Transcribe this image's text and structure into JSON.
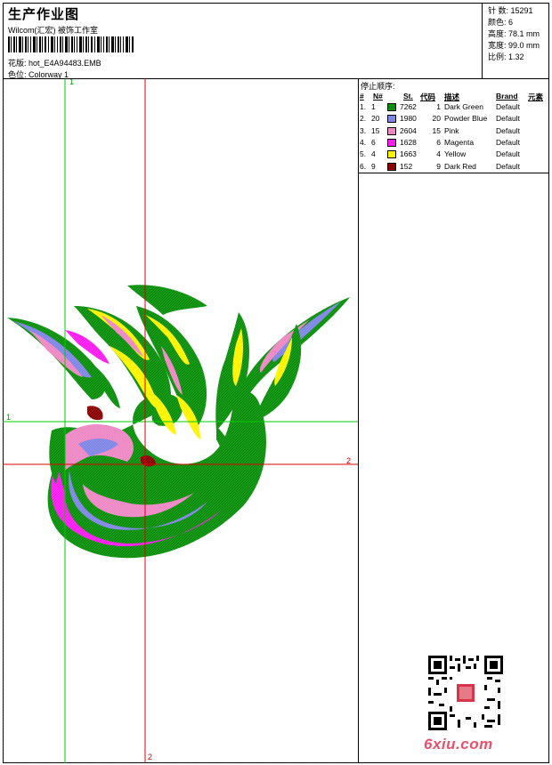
{
  "header": {
    "title": "生产作业图",
    "company": "Wilcom(汇宏)    被饰工作室",
    "design_label": "花版:",
    "design_value": "hot_E4A94483.EMB",
    "colorway_label": "色位:",
    "colorway_value": "Colorway 1"
  },
  "stats": [
    {
      "label": "针 数:",
      "value": "15291"
    },
    {
      "label": "颜色:",
      "value": "6"
    },
    {
      "label": "高度:",
      "value": "78.1 mm"
    },
    {
      "label": "宽度:",
      "value": "99.0 mm"
    },
    {
      "label": "比例:",
      "value": "1.32"
    }
  ],
  "stop_sequence": {
    "title": "停止顺序:",
    "headers": {
      "num": "#",
      "n": "N#",
      "st": "St.",
      "code": "代码",
      "desc": "描述",
      "brand": "Brand",
      "element": "元素"
    },
    "rows": [
      {
        "num": "1.",
        "n": "1",
        "color": "#0a8f0a",
        "st": "7262",
        "code": "1",
        "desc": "Dark Green",
        "brand": "Default"
      },
      {
        "num": "2.",
        "n": "20",
        "color": "#7f86e6",
        "st": "1980",
        "code": "20",
        "desc": "Powder Blue",
        "brand": "Default"
      },
      {
        "num": "3.",
        "n": "15",
        "color": "#ee88c4",
        "st": "2604",
        "code": "15",
        "desc": "Pink",
        "brand": "Default"
      },
      {
        "num": "4.",
        "n": "6",
        "color": "#ff1bf2",
        "st": "1628",
        "code": "6",
        "desc": "Magenta",
        "brand": "Default"
      },
      {
        "num": "5.",
        "n": "4",
        "color": "#fff400",
        "st": "1663",
        "code": "4",
        "desc": "Yellow",
        "brand": "Default"
      },
      {
        "num": "6.",
        "n": "9",
        "color": "#8b0000",
        "st": "152",
        "code": "9",
        "desc": "Dark Red",
        "brand": "Default"
      }
    ]
  },
  "guides": {
    "green_top": "1",
    "green_left": "1",
    "red_right": "2",
    "red_bottom": "2"
  },
  "watermark": "6xiu.com"
}
